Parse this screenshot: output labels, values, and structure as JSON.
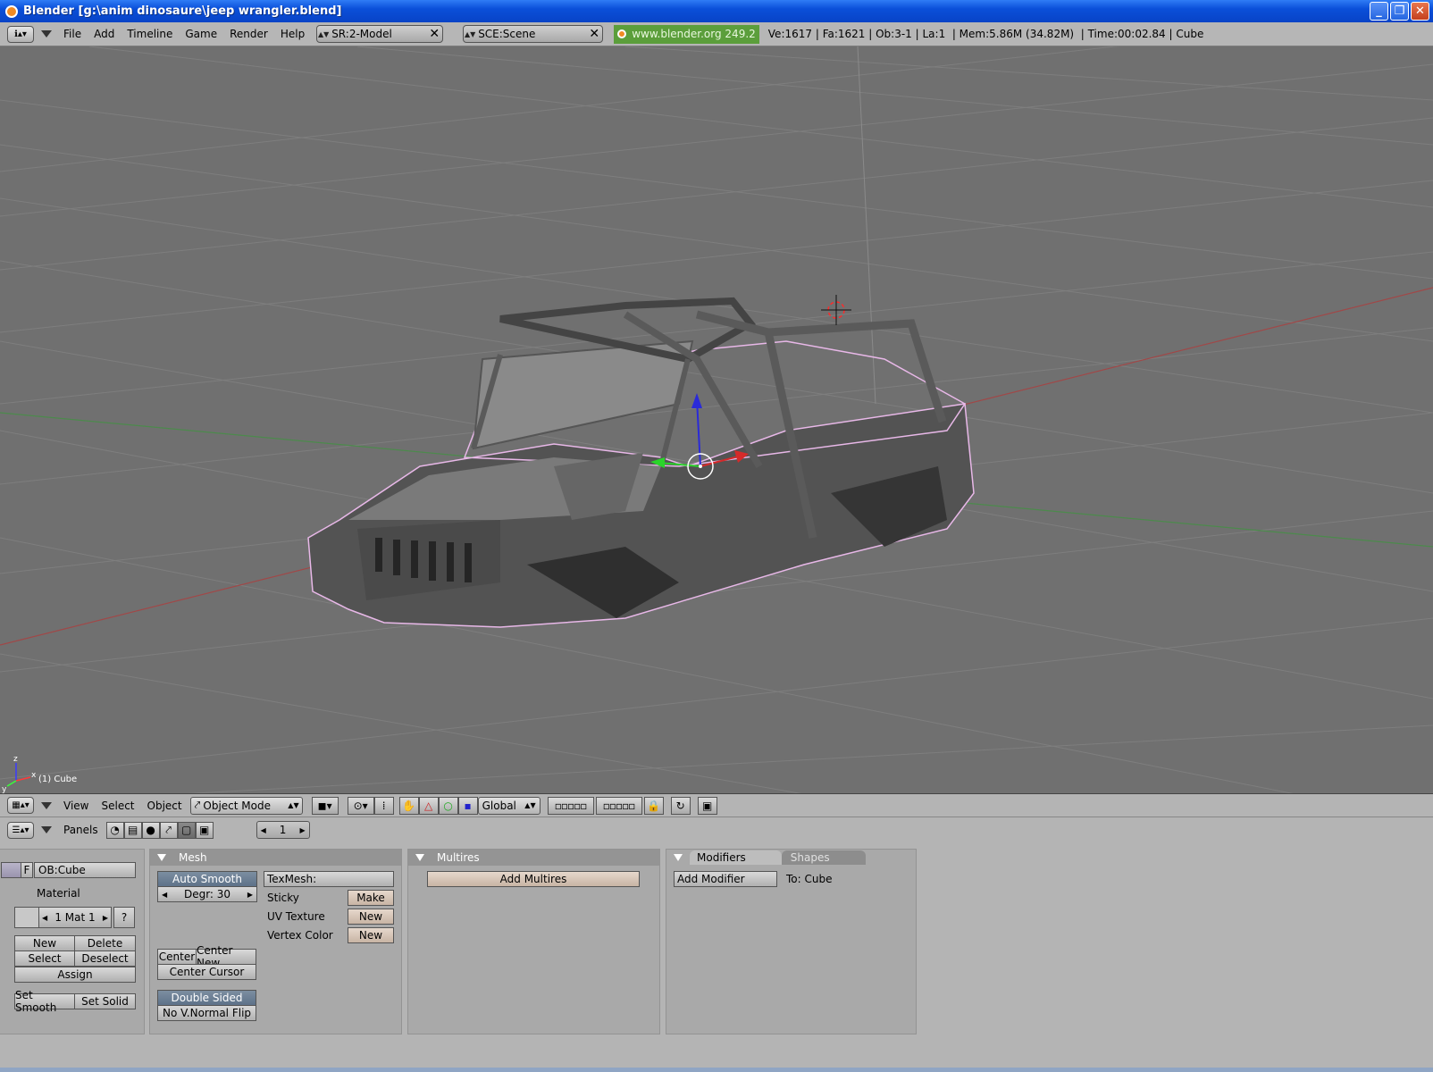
{
  "window": {
    "title": "Blender [g:\\anim dinosaure\\jeep wrangler.blend]",
    "minimize": "_",
    "maximize": "❐",
    "close": "✕"
  },
  "infobar": {
    "menus": [
      "File",
      "Add",
      "Timeline",
      "Game",
      "Render",
      "Help"
    ],
    "screen": "SR:2-Model",
    "scene": "SCE:Scene",
    "website": "www.blender.org 249.2",
    "stats": "Ve:1617 | Fa:1621 | Ob:3-1 | La:1  | Mem:5.86M (34.82M)  | Time:00:02.84 | Cube"
  },
  "viewport": {
    "object_label": "(1) Cube",
    "axes": {
      "z": "z",
      "x": "x",
      "y": "y"
    }
  },
  "view3d_header": {
    "menus": [
      "View",
      "Select",
      "Object"
    ],
    "mode": "Object Mode",
    "orientation": "Global"
  },
  "buttons_header": {
    "panels_label": "Panels",
    "frame": "1"
  },
  "link_panel": {
    "f_label": "F",
    "object_name": "OB:Cube",
    "material_label": "Material",
    "material_slot": "1 Mat 1",
    "question": "?",
    "new": "New",
    "delete": "Delete",
    "select": "Select",
    "deselect": "Deselect",
    "assign": "Assign",
    "set_smooth": "Set Smooth",
    "set_solid": "Set Solid"
  },
  "mesh_panel": {
    "title": "Mesh",
    "auto_smooth": "Auto Smooth",
    "degr": "Degr: 30",
    "texmesh": "TexMesh:",
    "sticky": "Sticky",
    "make": "Make",
    "uv_texture": "UV Texture",
    "uv_new": "New",
    "vertex_color": "Vertex Color",
    "vc_new": "New",
    "center": "Center",
    "center_new": "Center New",
    "center_cursor": "Center Cursor",
    "double_sided": "Double Sided",
    "no_vnormal_flip": "No V.Normal Flip"
  },
  "multires_panel": {
    "title": "Multires",
    "add_multires": "Add Multires"
  },
  "modifiers_panel": {
    "tab_modifiers": "Modifiers",
    "tab_shapes": "Shapes",
    "add_modifier": "Add Modifier",
    "to": "To: Cube"
  }
}
